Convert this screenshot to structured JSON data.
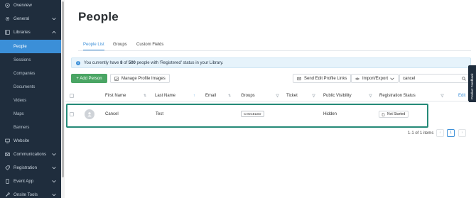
{
  "sidebar": {
    "items": [
      {
        "label": "Overview",
        "icon": "compass-icon"
      },
      {
        "label": "General",
        "icon": "settings-icon"
      },
      {
        "label": "Libraries",
        "icon": "library-icon"
      },
      {
        "label": "Website",
        "icon": "monitor-icon"
      },
      {
        "label": "Communications",
        "icon": "mail-icon"
      },
      {
        "label": "Registration",
        "icon": "tag-icon"
      },
      {
        "label": "Event App",
        "icon": "mobile-icon"
      },
      {
        "label": "Onsite Tools",
        "icon": "tools-icon"
      }
    ],
    "libraries_sub": [
      "People",
      "Sessions",
      "Companies",
      "Documents",
      "Videos",
      "Maps",
      "Banners"
    ]
  },
  "page": {
    "title": "People"
  },
  "tabs": [
    "People List",
    "Groups",
    "Custom Fields"
  ],
  "info": {
    "prefix": "You currently have",
    "count": "8",
    "of": "of",
    "total": "500",
    "suffix": "people with 'Registered' status in your Library."
  },
  "toolbar": {
    "add_label": "+ Add Person",
    "manage_label": "Manage Profile Images",
    "send_label": "Send Edit Profile Links",
    "import_label": "Import/Export",
    "search_value": "cancel"
  },
  "feedback_label": "Product Feedback",
  "table": {
    "headers": [
      "First Name",
      "Last Name",
      "Email",
      "Groups",
      "Ticket",
      "Public Visibility",
      "Registration Status"
    ],
    "edit_label": "Edit",
    "rows": [
      {
        "first": "Cancel",
        "last": "Test",
        "email": "",
        "group": "CANCELED",
        "ticket": "",
        "visibility": "Hidden",
        "status": "Not Started"
      }
    ]
  },
  "pager": {
    "summary": "1-1 of 1 items",
    "page": "1",
    "prev": "‹",
    "next": "›"
  },
  "colors": {
    "sidebar": "#1f2d3d",
    "accent": "#3b8fd8",
    "add_button": "#4aa564",
    "highlight": "#258a78"
  }
}
